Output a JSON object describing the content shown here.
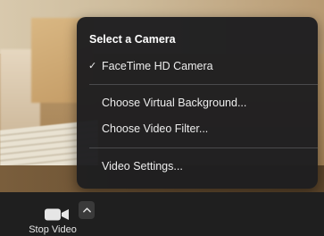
{
  "camera_menu": {
    "heading": "Select a Camera",
    "items": [
      {
        "label": "FaceTime HD Camera",
        "selected": true
      },
      {
        "label": "Choose Virtual Background..."
      },
      {
        "label": "Choose Video Filter..."
      },
      {
        "label": "Video Settings..."
      }
    ],
    "check_glyph": "✓"
  },
  "control_bar": {
    "stop_video_label": "Stop Video",
    "camera_icon": "video-camera-icon",
    "caret_icon": "chevron-up-icon"
  }
}
